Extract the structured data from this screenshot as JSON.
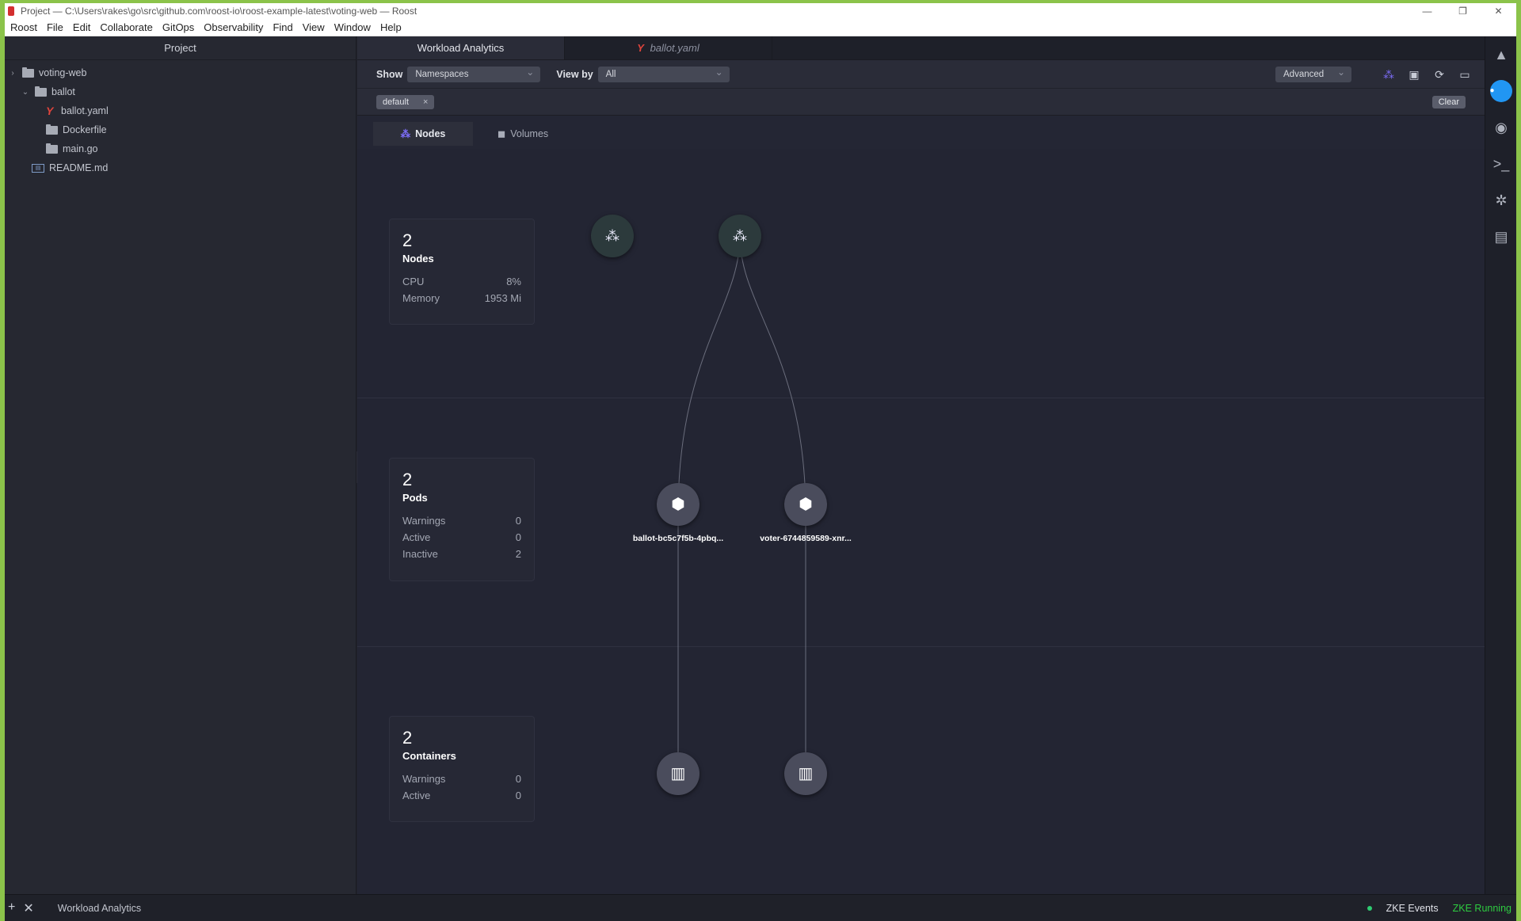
{
  "window": {
    "title": "Project — C:\\Users\\rakes\\go\\src\\github.com\\roost-io\\roost-example-latest\\voting-web — Roost",
    "minimize": "—",
    "restore": "❐",
    "close": "✕"
  },
  "menu": [
    "Roost",
    "File",
    "Edit",
    "Collaborate",
    "GitOps",
    "Observability",
    "Find",
    "View",
    "Window",
    "Help"
  ],
  "project": {
    "header": "Project",
    "tree": [
      {
        "label": "voting-web",
        "type": "folder",
        "depth": 0,
        "expanded": true
      },
      {
        "label": "ballot",
        "type": "folder",
        "depth": 1,
        "expanded": true
      },
      {
        "label": "ballot.yaml",
        "type": "yaml",
        "depth": 2
      },
      {
        "label": "Dockerfile",
        "type": "folder",
        "depth": 2
      },
      {
        "label": "main.go",
        "type": "folder",
        "depth": 2
      },
      {
        "label": "README.md",
        "type": "md",
        "depth": 1
      }
    ]
  },
  "tabs": {
    "workload": "Workload Analytics",
    "ballot": "ballot.yaml"
  },
  "toolbar": {
    "show_label": "Show",
    "show_value": "Namespaces",
    "viewby_label": "View by",
    "viewby_value": "All",
    "advanced": "Advanced"
  },
  "filter": {
    "chip": "default",
    "chip_close": "×",
    "clear": "Clear"
  },
  "view_tabs": {
    "nodes": "Nodes",
    "volumes": "Volumes"
  },
  "nodes_card": {
    "count": "2",
    "label": "Nodes",
    "rows": [
      {
        "k": "CPU",
        "v": "8%"
      },
      {
        "k": "Memory",
        "v": "1953 Mi"
      }
    ]
  },
  "pods_card": {
    "count": "2",
    "label": "Pods",
    "rows": [
      {
        "k": "Warnings",
        "v": "0"
      },
      {
        "k": "Active",
        "v": "0"
      },
      {
        "k": "Inactive",
        "v": "2"
      }
    ]
  },
  "containers_card": {
    "count": "2",
    "label": "Containers",
    "rows": [
      {
        "k": "Warnings",
        "v": "0"
      },
      {
        "k": "Active",
        "v": "0"
      }
    ]
  },
  "pods": {
    "ballot": "ballot-bc5c7f5b-4pbq...",
    "voter": "voter-6744859589-xnr..."
  },
  "status": {
    "add": "+",
    "close": "✕",
    "title": "Workload Analytics",
    "events": "ZKE Events",
    "running": "ZKE Running"
  }
}
